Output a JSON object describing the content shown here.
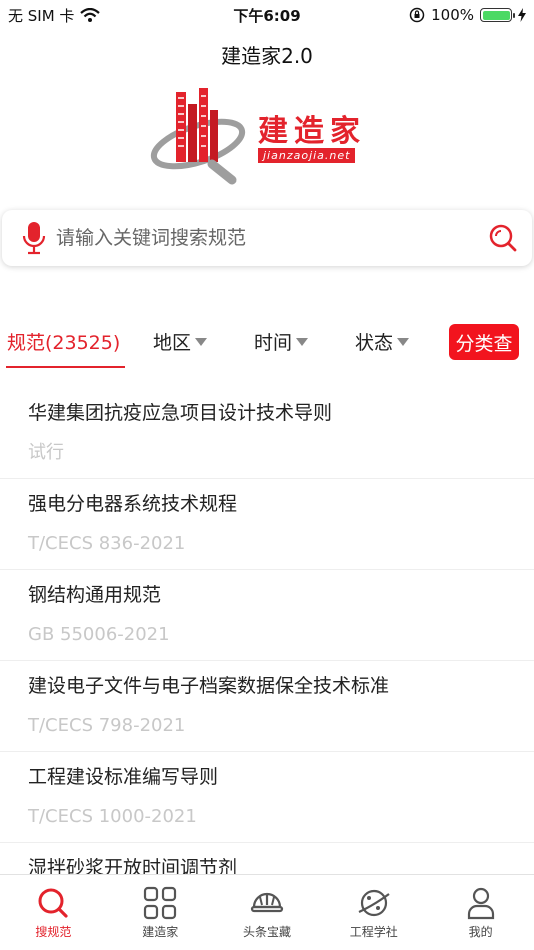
{
  "status_bar": {
    "carrier": "无 SIM 卡",
    "time": "下午6:09",
    "battery": "100%",
    "battery_level": 1.0
  },
  "nav": {
    "title": "建造家2.0"
  },
  "logo": {
    "text": "建造家",
    "url_text": "jianzaojia.net"
  },
  "search": {
    "placeholder": "请输入关键词搜索规范"
  },
  "filters": {
    "active_tab": "规范(23525)",
    "region": "地区",
    "time": "时间",
    "status": "状态",
    "classify_button": "分类查"
  },
  "list": [
    {
      "title": "华建集团抗疫应急项目设计技术导则",
      "code": "试行"
    },
    {
      "title": "强电分电器系统技术规程",
      "code": "T/CECS 836-2021"
    },
    {
      "title": "钢结构通用规范",
      "code": "GB 55006-2021"
    },
    {
      "title": "建设电子文件与电子档案数据保全技术标准",
      "code": "T/CECS 798-2021"
    },
    {
      "title": "工程建设标准编写导则",
      "code": "T/CECS 1000-2021"
    },
    {
      "title": "湿拌砂浆开放时间调节剂",
      "code": ""
    }
  ],
  "tab_bar": [
    {
      "label": "搜规范",
      "icon": "search-icon",
      "active": true
    },
    {
      "label": "建造家",
      "icon": "grid-icon",
      "active": false
    },
    {
      "label": "头条宝藏",
      "icon": "helmet-icon",
      "active": false
    },
    {
      "label": "工程学社",
      "icon": "planet-icon",
      "active": false
    },
    {
      "label": "我的",
      "icon": "person-icon",
      "active": false
    }
  ],
  "colors": {
    "accent": "#e3232c",
    "classify_bg": "#f2141e"
  }
}
